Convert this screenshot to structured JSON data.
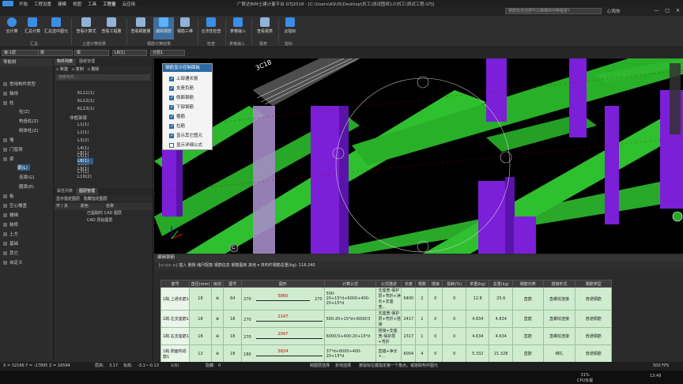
{
  "app": {
    "title": "广联达BIM土建计量平台 GTJ2018 - [C:\\Users\\ASUS\\Desktop\\刘工\\测试图纸12\\刘工\\测试工程.GTJ]",
    "menu": [
      "开始",
      "工程设置",
      "建模",
      "视图",
      "工具",
      "工程量",
      "云应用"
    ],
    "active_menu": "工程量",
    "search_placeholder": "钢筋有自动搜可以精确到何种程度?",
    "user": "心雨你",
    "window_controls": [
      "—",
      "□",
      "✕"
    ]
  },
  "ribbon": {
    "buttons": [
      {
        "label": "云计算",
        "color": "#3a8ee6"
      },
      {
        "label": "汇总计算",
        "color": "#3a8ee6"
      },
      {
        "label": "汇总选中图元",
        "color": "#3a8ee6"
      },
      {
        "label": "查看计算式",
        "color": "#8fb3d9"
      },
      {
        "label": "查看工程量",
        "color": "#8fb3d9"
      },
      {
        "label": "查看钢筋量",
        "color": "#8fb3d9"
      },
      {
        "label": "编辑钢筋",
        "color": "#5fb0ff"
      },
      {
        "label": "钢筋三维",
        "color": "#8fb3d9"
      },
      {
        "label": "合法性检查",
        "color": "#3a8ee6"
      },
      {
        "label": "表格输入",
        "color": "#3a8ee6"
      },
      {
        "label": "查看报表",
        "color": "#8fb3d9"
      },
      {
        "label": "云指标",
        "color": "#3a8ee6"
      }
    ],
    "groups": [
      "汇总",
      "土建计算结果",
      "钢筋计算结果",
      "检查",
      "表格输入",
      "报表",
      "指标"
    ]
  },
  "filters": {
    "floor": "第-1层",
    "type": "梁",
    "subtype": "梁",
    "element": "L8(1)",
    "layer": "分层1"
  },
  "nav": {
    "header": "导航树",
    "items": [
      "常用构件类型",
      "轴线",
      "柱",
      "柱(Z)",
      "构造柱(Z)",
      "砌体柱(Z)",
      "墙",
      "门窗洞",
      "梁",
      "梁(L)",
      "连梁(G)",
      "圈梁(E)",
      "板",
      "空心楼盖",
      "楼梯",
      "装修",
      "土方",
      "基础",
      "其它",
      "自定义"
    ],
    "selected": "梁(L)"
  },
  "list": {
    "tabs": [
      "构件列表",
      "图纸管理"
    ],
    "toolbar": [
      "新建",
      "复制",
      "删除"
    ],
    "search_placeholder": "搜索构件...",
    "items": [
      "KL11(1)",
      "KL12(1)",
      "KL13(1)",
      "非框架梁",
      "L1(1)",
      "L2(1)",
      "L3(2)",
      "L4(1)",
      "L5(1)",
      "L6(1)",
      "L7(1)",
      "L8(1)",
      "L9(1)",
      "L10(2)"
    ],
    "selected": "L8(1)"
  },
  "props": {
    "tabs": [
      "属性列表",
      "图层管理"
    ],
    "options": [
      "显示指定图层",
      "隐藏指定图层"
    ],
    "headers": [
      "开 / 关",
      "颜色",
      "名称"
    ],
    "rows": [
      {
        "name": "已提取的 CAD 图层"
      },
      {
        "name": "CAD 原始图层"
      }
    ]
  },
  "floatpanel": {
    "title": "钢筋显示控制面板",
    "options": [
      {
        "label": "上部通长筋",
        "checked": true
      },
      {
        "label": "支座负筋",
        "checked": true
      },
      {
        "label": "侧面钢筋",
        "checked": true
      },
      {
        "label": "下部钢筋",
        "checked": true
      },
      {
        "label": "箍筋",
        "checked": true
      },
      {
        "label": "拉筋",
        "checked": true
      },
      {
        "label": "显示其它图元",
        "checked": true
      },
      {
        "label": "显示详细公式",
        "checked": false
      }
    ]
  },
  "viewport": {
    "rebar_label": "3C18"
  },
  "editor": {
    "title": "编辑钢筋",
    "toolbar": "|◁  ◁  ▷  ▷|  插入  删除  缩尺配筋  钢筋信息  钢筋图库  其他 ▾  单构件钢筋总重(kg): 116.240",
    "headers": [
      "筋号",
      "直径(mm)",
      "级别",
      "图号",
      "图形",
      "计算公式",
      "公式描述",
      "长度",
      "根数",
      "搭接",
      "损耗(%)",
      "单重(kg)",
      "总重(kg)",
      "钢筋归类",
      "搭接形式",
      "钢筋类型"
    ],
    "rows": [
      {
        "no": "1",
        "name": "1跨.上通长筋1",
        "dia": "18",
        "grade": "⊕",
        "fig": "64",
        "left": "270",
        "len_shape": "5860",
        "right": "270",
        "formula": "500-20+15*d+6000+400-20+15*d",
        "desc": "支座宽-保护层+弯折+净长+支座宽...",
        "length": "6400",
        "count": "2",
        "lap": "0",
        "loss": "0",
        "unit_w": "12.8",
        "total_w": "25.6",
        "class": "直筋",
        "lap_type": "直螺纹连接",
        "type": "普通钢筋"
      },
      {
        "no": "2",
        "name": "1跨.左支座筋1",
        "dia": "18",
        "grade": "⊕",
        "fig": "18",
        "left": "270",
        "len_shape": "2147",
        "right": "",
        "formula": "500-20+15*d+6000/3",
        "desc": "支座宽-保护层+弯折+搭接",
        "length": "2417",
        "count": "1",
        "lap": "0",
        "loss": "0",
        "unit_w": "4.834",
        "total_w": "4.834",
        "class": "直筋",
        "lap_type": "直螺纹连接",
        "type": "普通钢筋"
      },
      {
        "no": "3",
        "name": "1跨.右支座筋1",
        "dia": "18",
        "grade": "⊕",
        "fig": "18",
        "left": "270",
        "len_shape": "2047",
        "right": "",
        "formula": "6000/3+400-20+15*d",
        "desc": "搭接+支座宽-保护层+弯折",
        "length": "2317",
        "count": "1",
        "lap": "0",
        "loss": "0",
        "unit_w": "4.634",
        "total_w": "4.634",
        "class": "直筋",
        "lap_type": "直螺纹连接",
        "type": "普通钢筋"
      },
      {
        "no": "4",
        "name": "1跨.侧面构造筋1",
        "dia": "12",
        "grade": "⊕",
        "fig": "18",
        "left": "180",
        "len_shape": "5824",
        "right": "",
        "formula": "37*d+6000+400-20+15*d",
        "desc": "直锚+净长+...",
        "length": "6004",
        "count": "4",
        "lap": "0",
        "loss": "0",
        "unit_w": "5.332",
        "total_w": "21.328",
        "class": "直筋",
        "lap_type": "绑扎",
        "type": "普通钢筋"
      }
    ]
  },
  "status": {
    "coords": "X = 32166 Y = -17895 Z = 16594",
    "floor_height_label": "层高:",
    "floor_height": "3.17",
    "elevation_label": "标高:",
    "elevation": "-3.1~-0.13",
    "count": "1(6)",
    "hidden_label": "隐藏:",
    "hidden": "0",
    "modes": [
      "跨图层选择",
      "折线选择"
    ],
    "hint": "按鼠标左键指定第一个角点，或拾取构件图元",
    "fps": "500 FPS"
  },
  "taskbar": {
    "cpu_pct": "31%",
    "cpu_label": "CPU负载",
    "time": "13:49"
  }
}
